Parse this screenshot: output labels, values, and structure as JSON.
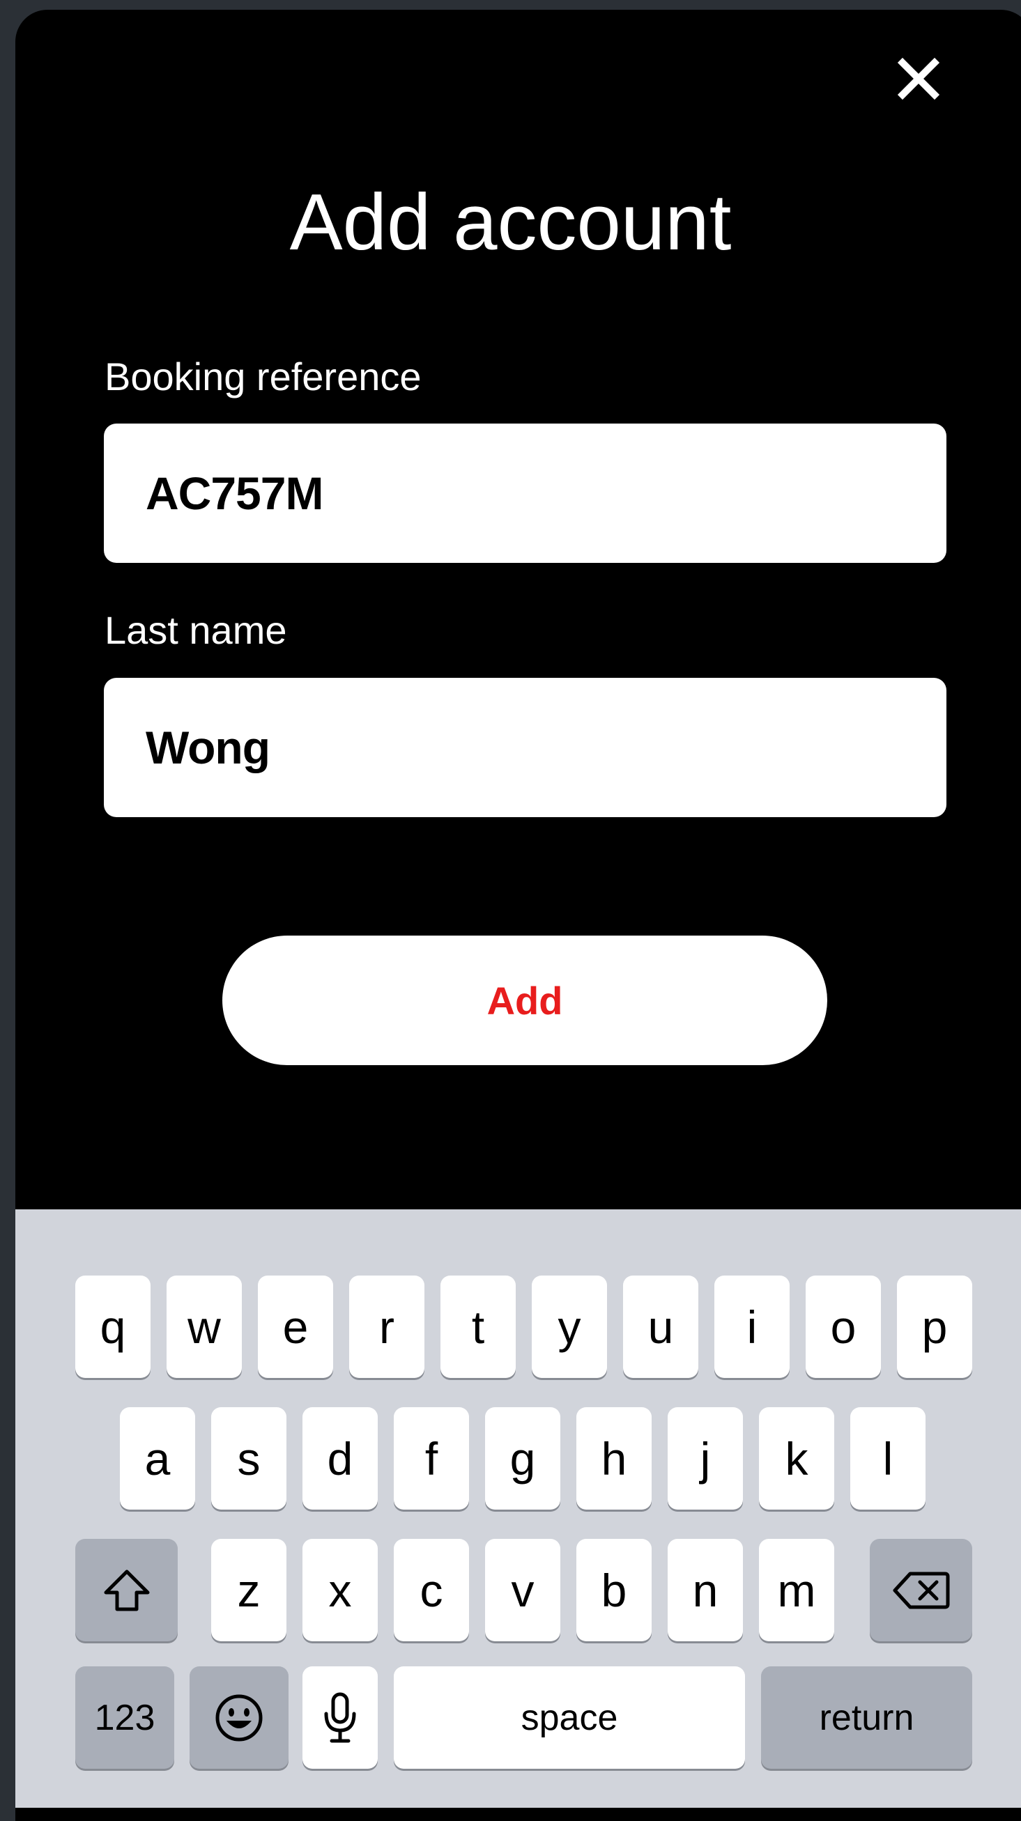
{
  "dialog": {
    "title": "Add account",
    "close_icon": "close-icon",
    "fields": [
      {
        "label": "Booking reference",
        "value": "AC757M"
      },
      {
        "label": "Last name",
        "value": "Wong"
      }
    ],
    "add_label": "Add",
    "add_color": "#e81d1d"
  },
  "keyboard": {
    "row1": [
      "q",
      "w",
      "e",
      "r",
      "t",
      "y",
      "u",
      "i",
      "o",
      "p"
    ],
    "row2": [
      "a",
      "s",
      "d",
      "f",
      "g",
      "h",
      "j",
      "k",
      "l"
    ],
    "row3": [
      "z",
      "x",
      "c",
      "v",
      "b",
      "n",
      "m"
    ],
    "numbers_label": "123",
    "space_label": "space",
    "return_label": "return",
    "shift_icon": "shift-icon",
    "delete_icon": "delete-icon",
    "emoji_icon": "emoji-icon",
    "mic_icon": "microphone-icon"
  }
}
